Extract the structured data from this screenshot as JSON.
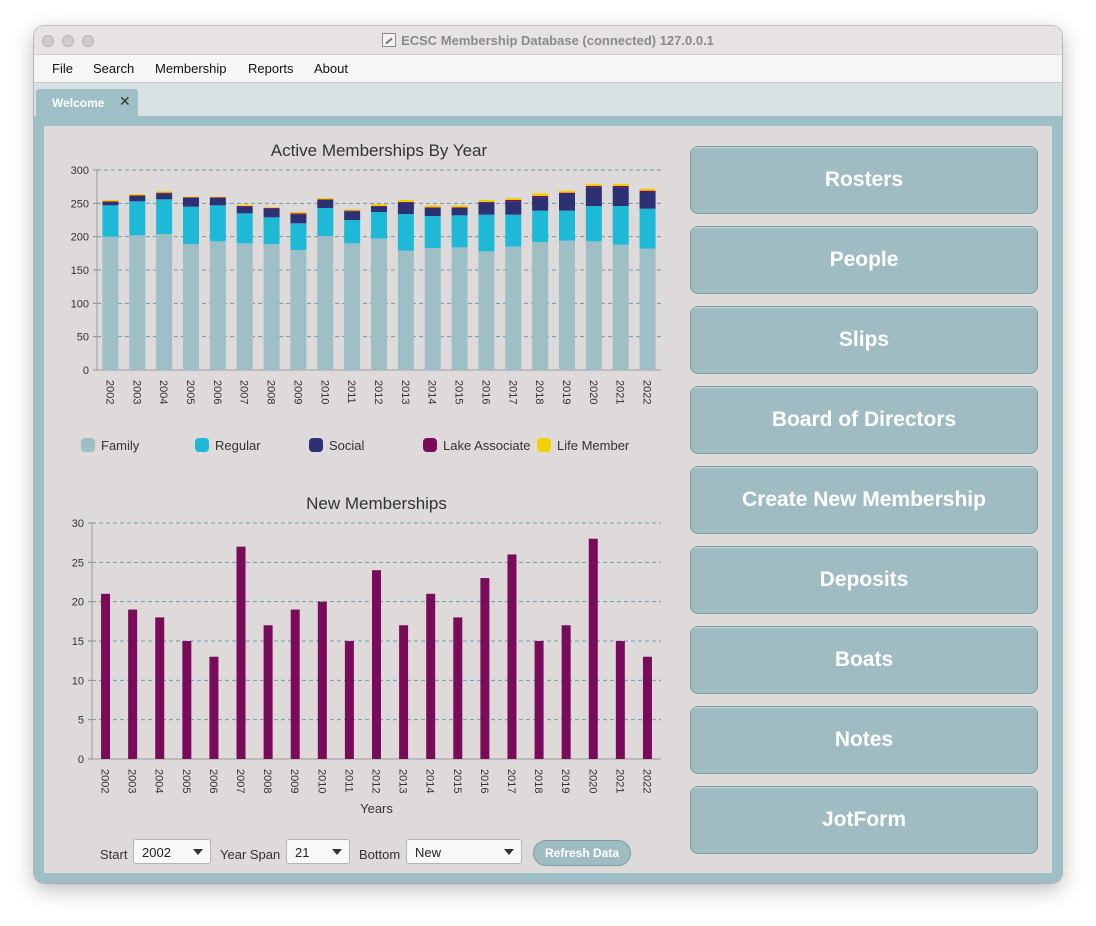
{
  "window": {
    "title": "ECSC Membership Database (connected) 127.0.0.1"
  },
  "menu": [
    "File",
    "Search",
    "Membership",
    "Reports",
    "About"
  ],
  "tabs": [
    {
      "label": "Welcome",
      "close_glyph": "✕"
    }
  ],
  "side_buttons": [
    "Rosters",
    "People",
    "Slips",
    "Board of Directors",
    "Create New Membership",
    "Deposits",
    "Boats",
    "Notes",
    "JotForm"
  ],
  "controls": {
    "start_label": "Start",
    "start_value": "2002",
    "span_label": "Year Span",
    "span_value": "21",
    "bottom_label": "Bottom",
    "bottom_value": "New",
    "refresh_label": "Refresh Data"
  },
  "colors": {
    "family": "#9ebfc6",
    "regular": "#1fb9d8",
    "social": "#2b3172",
    "lake_associate": "#7a0a5a",
    "life_member": "#f1cf05"
  },
  "chart_data": [
    {
      "type": "bar",
      "stacked": true,
      "title": "Active Memberships By Year",
      "categories": [
        "2002",
        "2003",
        "2004",
        "2005",
        "2006",
        "2007",
        "2008",
        "2009",
        "2010",
        "2011",
        "2012",
        "2013",
        "2014",
        "2015",
        "2016",
        "2017",
        "2018",
        "2019",
        "2020",
        "2021",
        "2022"
      ],
      "ylim": [
        0,
        300
      ],
      "yticks": [
        0,
        50,
        100,
        150,
        200,
        250,
        300
      ],
      "grid": true,
      "legend_position": "bottom",
      "series": [
        {
          "name": "Family",
          "values": [
            200,
            202,
            204,
            189,
            193,
            190,
            189,
            180,
            201,
            190,
            197,
            179,
            183,
            184,
            178,
            185,
            192,
            194,
            193,
            188,
            182
          ]
        },
        {
          "name": "Regular",
          "values": [
            47,
            51,
            52,
            56,
            54,
            45,
            40,
            40,
            42,
            35,
            40,
            55,
            48,
            48,
            55,
            48,
            47,
            45,
            53,
            58,
            60
          ]
        },
        {
          "name": "Social",
          "values": [
            5,
            8,
            9,
            13,
            11,
            10,
            13,
            13,
            12,
            13,
            8,
            17,
            12,
            11,
            18,
            20,
            20,
            25,
            28,
            28,
            25
          ]
        },
        {
          "name": "Lake Associate",
          "values": [
            1,
            1,
            1,
            1,
            1,
            1,
            1,
            2,
            1,
            1,
            1,
            1,
            1,
            1,
            1,
            2,
            2,
            2,
            2,
            2,
            2
          ]
        },
        {
          "name": "Life Member",
          "values": [
            2,
            2,
            2,
            1,
            1,
            2,
            1,
            2,
            2,
            2,
            3,
            3,
            3,
            3,
            3,
            3,
            4,
            3,
            3,
            3,
            3
          ]
        }
      ]
    },
    {
      "type": "bar",
      "title": "New Memberships",
      "xlabel": "Years",
      "categories": [
        "2002",
        "2003",
        "2004",
        "2005",
        "2006",
        "2007",
        "2008",
        "2009",
        "2010",
        "2011",
        "2012",
        "2013",
        "2014",
        "2015",
        "2016",
        "2017",
        "2018",
        "2019",
        "2020",
        "2021",
        "2022"
      ],
      "values": [
        21,
        19,
        18,
        15,
        13,
        27,
        17,
        19,
        20,
        15,
        24,
        17,
        21,
        18,
        23,
        26,
        15,
        17,
        28,
        15,
        13
      ],
      "ylim": [
        0,
        30
      ],
      "yticks": [
        0,
        5,
        10,
        15,
        20,
        25,
        30
      ],
      "grid": true
    }
  ]
}
